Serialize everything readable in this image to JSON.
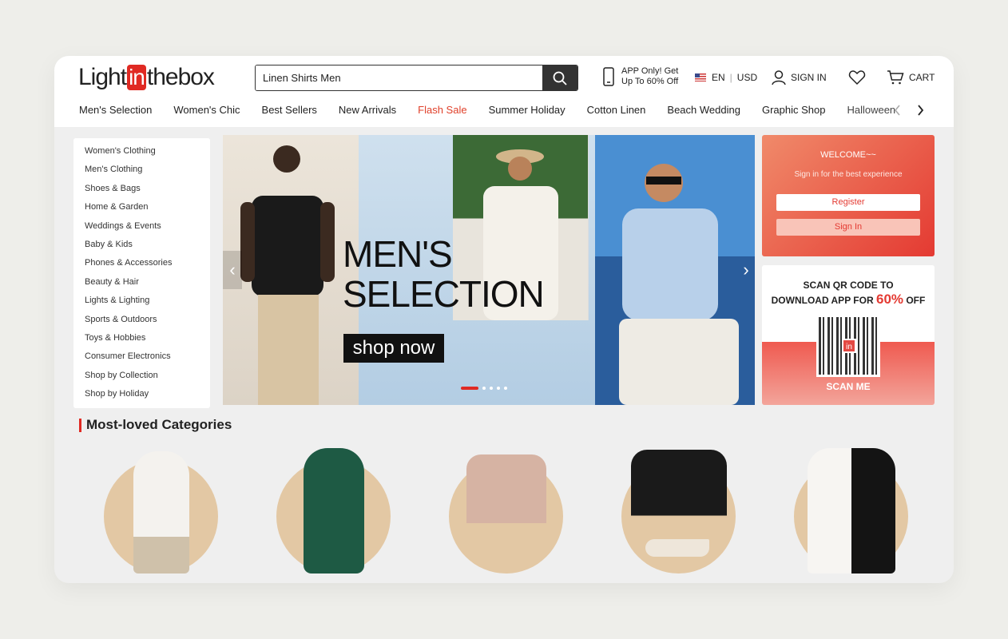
{
  "header": {
    "logo_text_1": "Light",
    "logo_text_2": "in",
    "logo_text_3": "thebox",
    "search_value": "Linen Shirts Men",
    "app_promo_line1": "APP Only! Get",
    "app_promo_line2": "Up To 60% Off",
    "lang": "EN",
    "currency": "USD",
    "signin": "SIGN IN",
    "cart": "CART"
  },
  "nav": {
    "items": [
      "Men's Selection",
      "Women's Chic",
      "Best Sellers",
      "New Arrivals",
      "Flash Sale",
      "Summer Holiday",
      "Cotton Linen",
      "Beach Wedding",
      "Graphic Shop",
      "Halloween"
    ]
  },
  "sidebar": {
    "items": [
      "Women's Clothing",
      "Men's Clothing",
      "Shoes & Bags",
      "Home & Garden",
      "Weddings & Events",
      "Baby & Kids",
      "Phones & Accessories",
      "Beauty & Hair",
      "Lights & Lighting",
      "Sports & Outdoors",
      "Toys & Hobbies",
      "Consumer Electronics",
      "Shop by Collection",
      "Shop by Holiday"
    ]
  },
  "banner": {
    "title_line1": "MEN'S",
    "title_line2": "SELECTION",
    "cta": "shop now",
    "slides": 5,
    "active_slide": 1
  },
  "welcome": {
    "title": "WELCOME~~",
    "subtitle": "Sign in for the best experience",
    "register": "Register",
    "signin": "Sign In"
  },
  "qr": {
    "line1": "SCAN QR CODE TO",
    "line2_prefix": "DOWNLOAD APP FOR ",
    "line2_pct": "60%",
    "line2_suffix": " OFF",
    "logo": "in",
    "scan_me": "SCAN ME"
  },
  "categories": {
    "title": "Most-loved Categories"
  },
  "colors": {
    "brand_red": "#e02a23",
    "flash_sale": "#e0402a"
  }
}
